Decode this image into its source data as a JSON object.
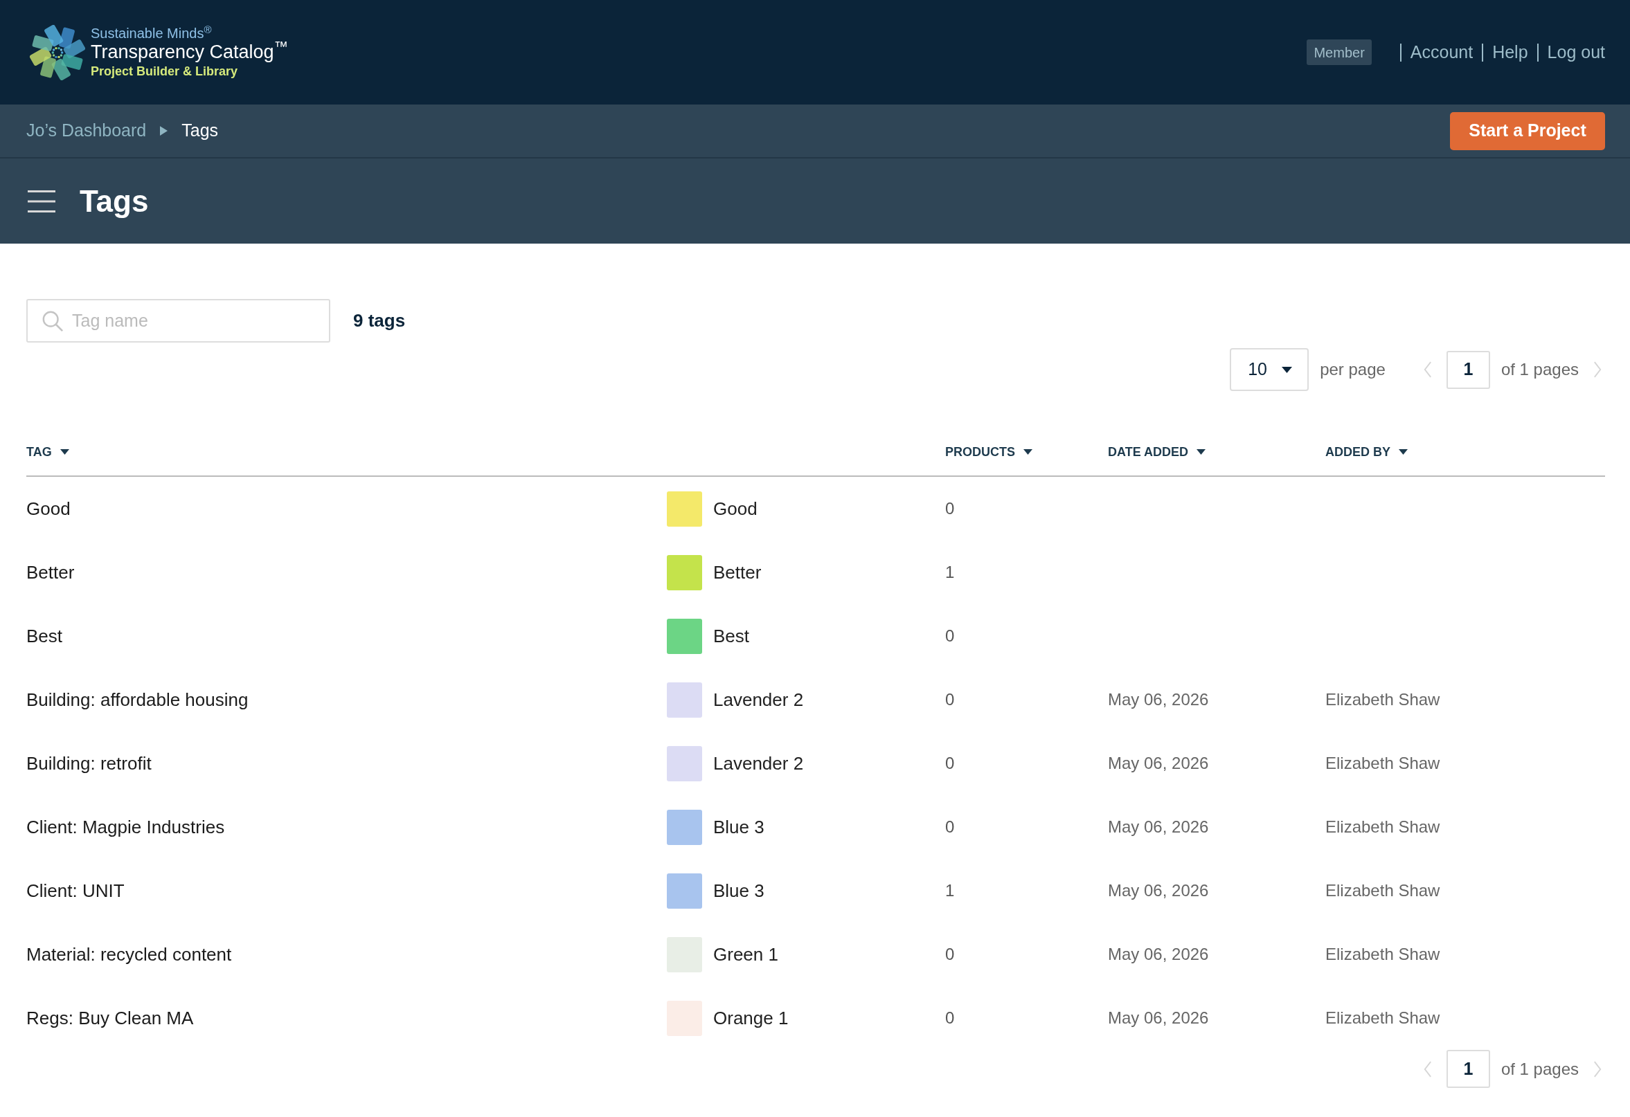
{
  "header": {
    "logo": {
      "line_1": "Sustainable Minds$^{®}$",
      "line_2": "Transparency Catalog$^{™}$",
      "line_3": "Project Builder & Library"
    },
    "user_badge": "Member",
    "nav_links": [
      "Account",
      "Help",
      "Log out"
    ]
  },
  "breadcrumb": [
    {
      "label": "Jo’s Dashboard",
      "current": false
    },
    {
      "label": "Tags",
      "current": true
    }
  ],
  "primary_button": "Start a Project",
  "page_title": "Tags",
  "search": {
    "placeholder": "Tag name"
  },
  "tag_count": "9 tags",
  "pagination_top": {
    "per_page": "10",
    "per_page_label": "per page",
    "page": "1",
    "total_label": "of 1 pages",
    "previous_disabled": true,
    "next_disabled": true
  },
  "table": {
    "columns": [
      "TAG",
      "PRODUCTS",
      "DATE ADDED",
      "ADDED BY"
    ],
    "rows": [
      {
        "tag": "Good",
        "color_label": "Good",
        "color": "#f4e96a",
        "products": "0"
      },
      {
        "tag": "Better",
        "color_label": "Better",
        "color": "#c4e34b",
        "products": "1"
      },
      {
        "tag": "Best",
        "color_label": "Best",
        "color": "#6cd585",
        "products": "0"
      },
      {
        "tag": "Building: affordable housing",
        "color_label": "Lavender 2",
        "color": "#dcdcf4",
        "products": "0",
        "date_added": "May 06, 2026",
        "added_by": "Elizabeth Shaw"
      },
      {
        "tag": "Building: retrofit",
        "color_label": "Lavender 2",
        "color": "#dcdcf4",
        "products": "0",
        "date_added": "May 06, 2026",
        "added_by": "Elizabeth Shaw"
      },
      {
        "tag": "Client: Magpie Industries",
        "color_label": "Blue 3",
        "color": "#a8c4ee",
        "products": "0",
        "date_added": "May 06, 2026",
        "added_by": "Elizabeth Shaw"
      },
      {
        "tag": "Client: UNIT",
        "color_label": "Blue 3",
        "color": "#a8c4ee",
        "products": "1",
        "date_added": "May 06, 2026",
        "added_by": "Elizabeth Shaw"
      },
      {
        "tag": "Material: recycled content",
        "color_label": "Green 1",
        "color": "#e8eee6",
        "products": "0",
        "date_added": "May 06, 2026",
        "added_by": "Elizabeth Shaw"
      },
      {
        "tag": "Regs: Buy Clean MA",
        "color_label": "Orange 1",
        "color": "#fbede7",
        "products": "0",
        "date_added": "May 06, 2026",
        "added_by": "Elizabeth Shaw"
      }
    ]
  },
  "pagination_bottom": {
    "page": "1",
    "total_label": "of 1 pages",
    "previous_disabled": true,
    "next_disabled": true
  }
}
